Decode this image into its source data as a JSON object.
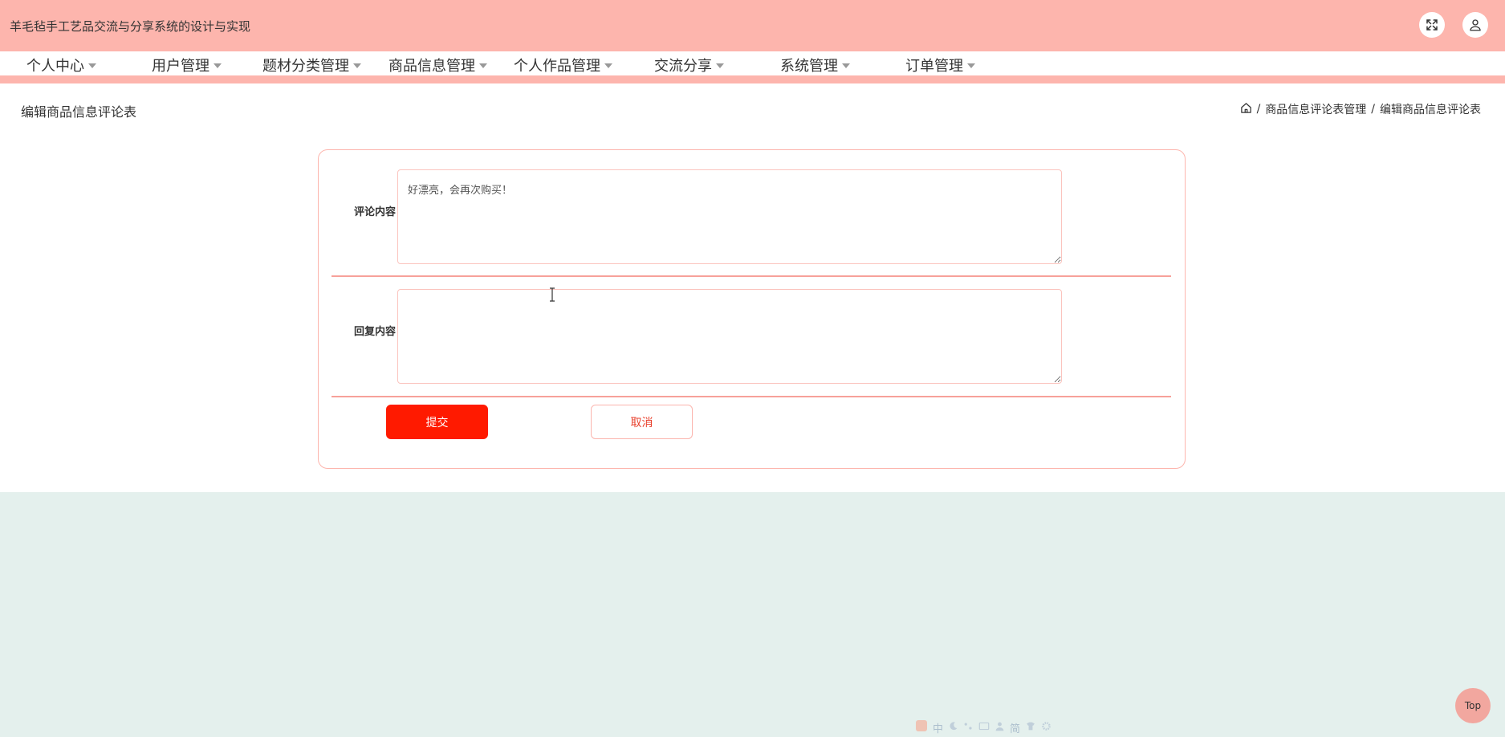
{
  "app": {
    "title": "羊毛毡手工艺品交流与分享系统的设计与实现"
  },
  "header": {
    "icons": [
      "fullscreen-icon",
      "user-icon"
    ]
  },
  "nav": {
    "items": [
      {
        "label": "个人中心"
      },
      {
        "label": "用户管理"
      },
      {
        "label": "题材分类管理"
      },
      {
        "label": "商品信息管理"
      },
      {
        "label": "个人作品管理"
      },
      {
        "label": "交流分享"
      },
      {
        "label": "系统管理"
      },
      {
        "label": "订单管理"
      }
    ]
  },
  "page": {
    "title": "编辑商品信息评论表",
    "breadcrumb": {
      "sep1": "/",
      "level1": "商品信息评论表管理",
      "sep2": "/",
      "level2": "编辑商品信息评论表"
    }
  },
  "form": {
    "comment_label": "评论内容",
    "comment_value": "好漂亮，会再次购买！",
    "reply_label": "回复内容",
    "reply_value": "",
    "submit_label": "提交",
    "cancel_label": "取消"
  },
  "ime": {
    "glyphs": [
      "中",
      "简"
    ]
  },
  "top_button": {
    "label": "Top"
  },
  "colors": {
    "header_bg": "#fdb5ad",
    "submit_bg": "#ff1a00",
    "bottom_bg": "#e4f0ed"
  }
}
